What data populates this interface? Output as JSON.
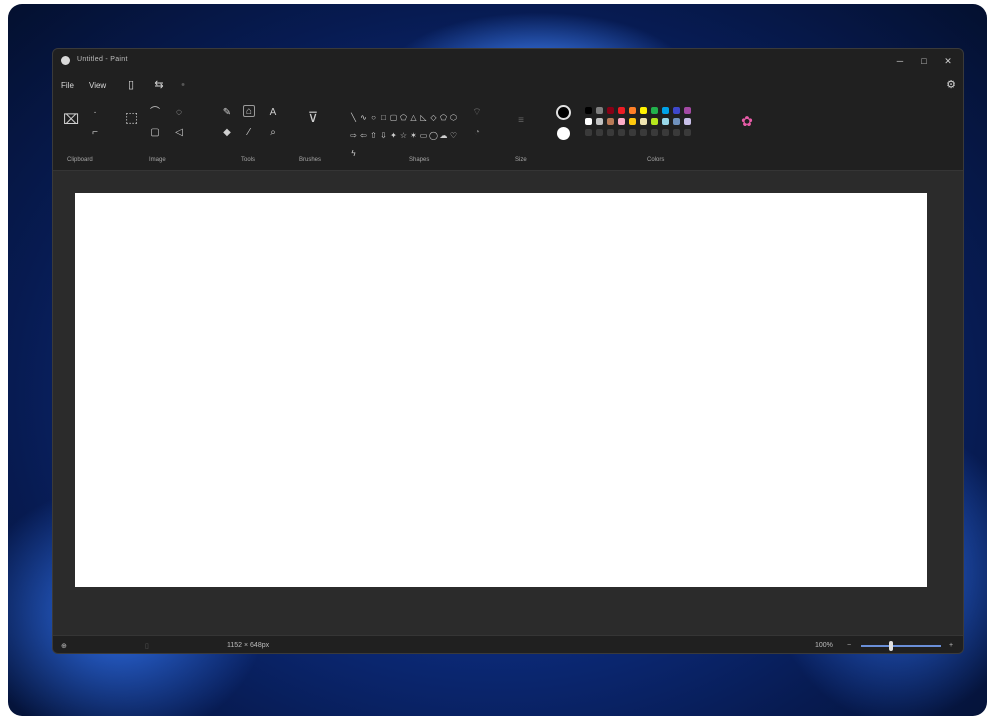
{
  "window": {
    "title": "Untitled - Paint",
    "minimize_glyph": "─",
    "maximize_glyph": "□",
    "close_glyph": "✕"
  },
  "menu": {
    "file": "File",
    "view": "View",
    "save_icon": "save-icon",
    "undo_icon": "undo-icon",
    "redo_icon": "redo-icon",
    "settings_icon": "gear-icon"
  },
  "ribbon": {
    "groups": {
      "clipboard": "Clipboard",
      "image": "Image",
      "tools": "Tools",
      "brushes": "Brushes",
      "shapes": "Shapes",
      "size": "Size",
      "colors": "Colors"
    },
    "tool_text_glyph": "A",
    "primary_color": "#000000",
    "secondary_color": "#ffffff",
    "palette_row1": [
      "#000000",
      "#7f7f7f",
      "#880015",
      "#ed1c24",
      "#ff7f27",
      "#fff200",
      "#22b14c",
      "#00a2e8",
      "#3f48cc",
      "#a349a4"
    ],
    "palette_row2": [
      "#ffffff",
      "#c3c3c3",
      "#b97a57",
      "#ffaec9",
      "#ffc90e",
      "#efe4b0",
      "#b5e61d",
      "#99d9ea",
      "#7092be",
      "#c8bfe7"
    ]
  },
  "status": {
    "canvas_size": "1152 × 648px",
    "zoom": "100%"
  }
}
